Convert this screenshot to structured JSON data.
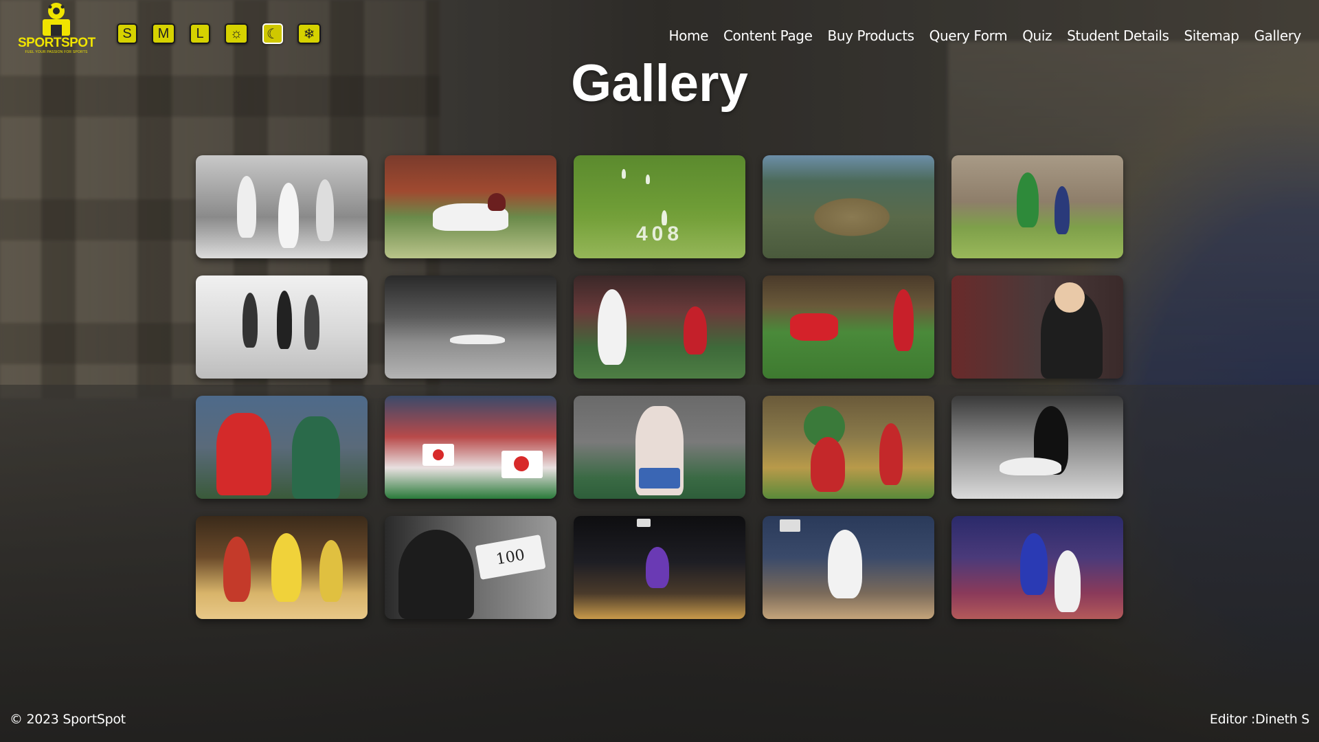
{
  "brand": {
    "name": "SPORTSPOT",
    "tagline": "FUEL YOUR PASSION FOR SPORTS",
    "color": "#f0e400"
  },
  "controls": [
    {
      "label": "S",
      "name": "font-small-button"
    },
    {
      "label": "M",
      "name": "font-medium-button"
    },
    {
      "label": "L",
      "name": "font-large-button"
    },
    {
      "label": "☼",
      "name": "light-theme-button",
      "icon": "sun-icon"
    },
    {
      "label": "☾",
      "name": "dark-theme-button",
      "icon": "moon-icon",
      "active": true
    },
    {
      "label": "❄",
      "name": "cool-theme-button",
      "icon": "snowflake-icon"
    }
  ],
  "nav": [
    "Home",
    "Content Page",
    "Buy Products",
    "Query Form",
    "Quiz",
    "Student Details",
    "Sitemap",
    "Gallery"
  ],
  "page_title": "Gallery",
  "gallery": [
    {
      "alt": "cricket-bw"
    },
    {
      "alt": "cricket-celebration"
    },
    {
      "alt": "cricket-pitch-408",
      "text": "408"
    },
    {
      "alt": "stadium-aerial"
    },
    {
      "alt": "cricket-green-kit"
    },
    {
      "alt": "football-coin-toss-bw"
    },
    {
      "alt": "football-goalkeeper-bw"
    },
    {
      "alt": "football-players"
    },
    {
      "alt": "football-goal-celebration"
    },
    {
      "alt": "young-fan-cheering"
    },
    {
      "alt": "rugby-player-coach"
    },
    {
      "alt": "rugby-team-japan"
    },
    {
      "alt": "rugby-player-bloodied"
    },
    {
      "alt": "rugby-lineout"
    },
    {
      "alt": "rugby-tackle-bw"
    },
    {
      "alt": "basketball-dribble"
    },
    {
      "alt": "basketball-100-sign",
      "text": "100"
    },
    {
      "alt": "basketball-dunk-arena"
    },
    {
      "alt": "basketball-jump-shot"
    },
    {
      "alt": "basketball-dunk-stars"
    }
  ],
  "footer": {
    "copyright": "© 2023 SportSpot",
    "editor": "Editor :Dineth S"
  }
}
